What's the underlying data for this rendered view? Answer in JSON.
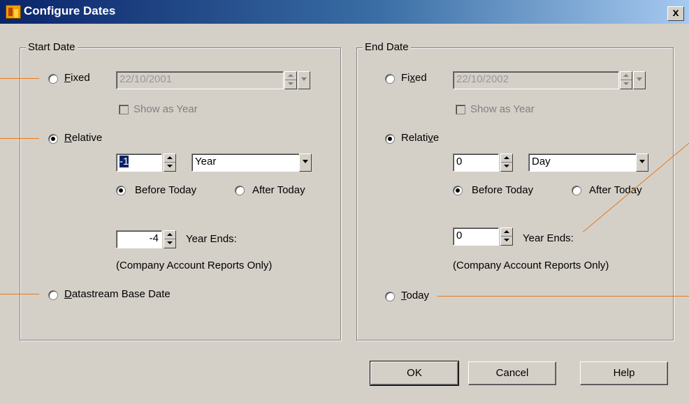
{
  "window": {
    "title": "Configure Dates",
    "close_label": "x"
  },
  "start": {
    "group_label": "Start Date",
    "fixed_label": "Fixed",
    "fixed_date": "22/10/2001",
    "show_as_year": "Show as Year",
    "relative_label": "Relative",
    "relative_value": "-1",
    "period": "Year",
    "before_today": "Before Today",
    "after_today": "After Today",
    "year_ends_value": "-4",
    "year_ends_label": "Year Ends:",
    "company_note": "(Company Account Reports Only)",
    "base_date_label": "Datastream Base Date",
    "selected": "relative",
    "direction": "before"
  },
  "end": {
    "group_label": "End Date",
    "fixed_label": "Fixed",
    "fixed_date": "22/10/2002",
    "show_as_year": "Show as Year",
    "relative_label": "Relative",
    "relative_value": "0",
    "period": "Day",
    "before_today": "Before Today",
    "after_today": "After Today",
    "year_ends_value": "0",
    "year_ends_label": "Year Ends:",
    "company_note": "(Company Account Reports Only)",
    "today_label": "Today",
    "selected": "relative",
    "direction": "before"
  },
  "buttons": {
    "ok": "OK",
    "cancel": "Cancel",
    "help": "Help"
  },
  "colors": {
    "title_bar": "#0a246a",
    "dialog": "#d4d0c8",
    "callout": "#e8781a"
  }
}
